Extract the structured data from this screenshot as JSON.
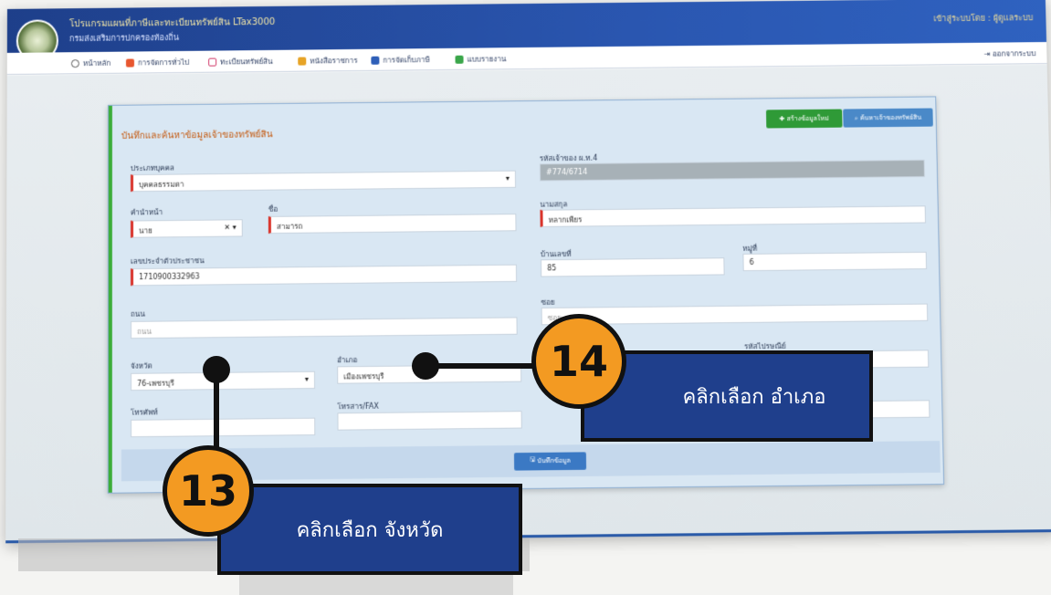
{
  "header": {
    "app_title": "โปรแกรมแผนที่ภาษีและทะเบียนทรัพย์สิน LTax3000",
    "app_subtitle": "กรมส่งเสริมการปกครองท้องถิ่น",
    "user_info": "เข้าสู่ระบบโดย : ผู้ดูแลระบบ"
  },
  "nav": {
    "items": [
      {
        "label": "หน้าหลัก",
        "icon": "home-icon"
      },
      {
        "label": "การจัดการทั่วไป",
        "icon": "gear-icon"
      },
      {
        "label": "ทะเบียนทรัพย์สิน",
        "icon": "book-icon"
      },
      {
        "label": "หนังสือราชการ",
        "icon": "document-icon"
      },
      {
        "label": "การจัดเก็บภาษี",
        "icon": "ledger-icon"
      },
      {
        "label": "แบบรายงาน",
        "icon": "report-icon"
      }
    ],
    "logout": "ออกจากระบบ"
  },
  "panel": {
    "title": "บันทึกและค้นหาข้อมูลเจ้าของทรัพย์สิน",
    "new_button": "สร้างข้อมูลใหม่",
    "search_button": "ค้นหาเจ้าของทรัพย์สิน"
  },
  "form": {
    "person_type_label": "ประเภทบุคคล",
    "person_type_value": "บุคคลธรรมดา",
    "owner_code_label": "รหัสเจ้าของ ผ.ท.4",
    "owner_code_value": "#774/6714",
    "prefix_label": "คำนำหน้า",
    "prefix_value": "นาย",
    "firstname_label": "ชื่อ",
    "firstname_value": "สามารถ",
    "lastname_label": "นามสกุล",
    "lastname_value": "หลากเพียร",
    "id_card_label": "เลขประจำตัวประชาชน",
    "id_card_value": "1710900332963",
    "house_no_label": "บ้านเลขที่",
    "house_no_value": "85",
    "moo_label": "หมู่ที่",
    "moo_value": "6",
    "road_label": "ถนน",
    "road_placeholder": "ถนน",
    "soi_label": "ซอย",
    "soi_placeholder": "ซอย",
    "province_label": "จังหวัด",
    "province_value": "76-เพชรบุรี",
    "district_label": "อำเภอ",
    "district_value": "เมืองเพชรบุรี",
    "postcode_label": "รหัสไปรษณีย์",
    "phone_label": "โทรศัพท์",
    "fax_label": "โทรสาร/FAX",
    "save_button": "บันทึกข้อมูล"
  },
  "callouts": {
    "step13_number": "13",
    "step13_text": "คลิกเลือก จังหวัด",
    "step14_number": "14",
    "step14_text": "คลิกเลือก อำเภอ"
  },
  "colors": {
    "topbar": "#2a56b0",
    "callout_badge": "#f39a22",
    "callout_box": "#1f3f8c",
    "required_marker": "#d9342b",
    "title_text": "#c45a11"
  }
}
